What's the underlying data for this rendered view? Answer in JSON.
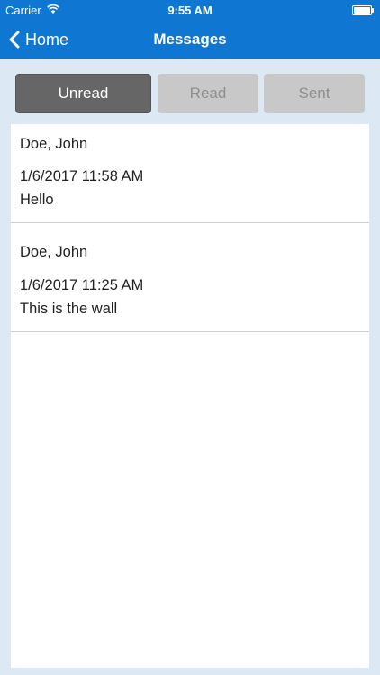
{
  "status_bar": {
    "carrier": "Carrier",
    "time": "9:55 AM"
  },
  "nav": {
    "back_label": "Home",
    "title": "Messages"
  },
  "tabs": [
    {
      "label": "Unread",
      "active": true
    },
    {
      "label": "Read",
      "active": false
    },
    {
      "label": "Sent",
      "active": false
    }
  ],
  "messages": [
    {
      "sender": "Doe, John",
      "date": "1/6/2017 11:58 AM",
      "body": "Hello"
    },
    {
      "sender": "Doe, John",
      "date": "1/6/2017 11:25 AM",
      "body": "This is the wall"
    }
  ],
  "colors": {
    "header": "#0f77d1",
    "page_background": "#dce9f5",
    "active_tab": "#666666",
    "inactive_tab": "#c8c8c8"
  }
}
